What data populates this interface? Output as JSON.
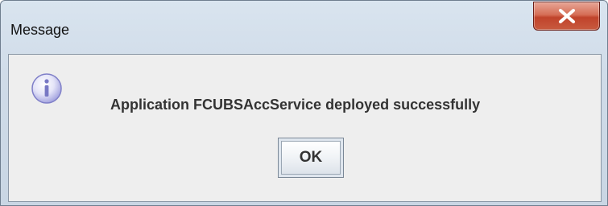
{
  "dialog": {
    "title": "Message",
    "message": "Application FCUBSAccService deployed successfully",
    "ok_label": "OK",
    "close_icon": "close-icon",
    "info_icon": "info-icon"
  },
  "colors": {
    "close_button": "#c0432b",
    "frame": "#cfdbe8",
    "client": "#eeeeee",
    "info_icon": "#8f8fd8"
  }
}
